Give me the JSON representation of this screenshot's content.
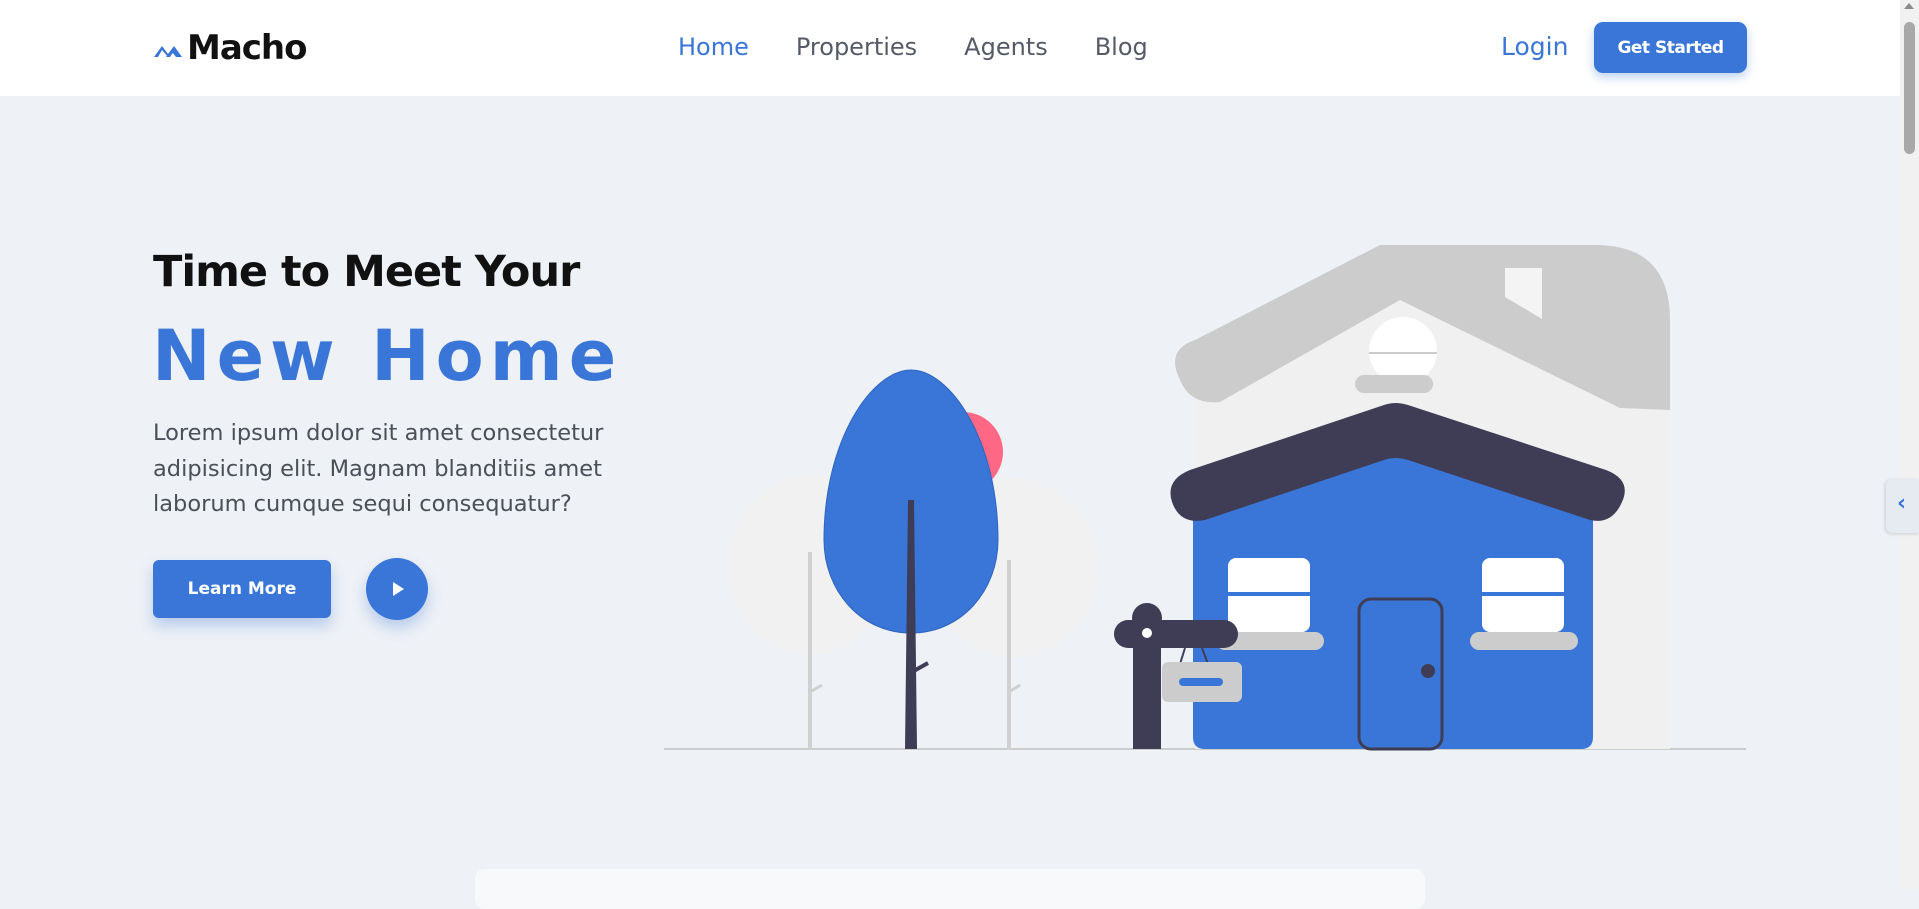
{
  "header": {
    "logo_text": "Macho",
    "nav": [
      {
        "label": "Home",
        "active": true
      },
      {
        "label": "Properties",
        "active": false
      },
      {
        "label": "Agents",
        "active": false
      },
      {
        "label": "Blog",
        "active": false
      }
    ],
    "login_label": "Login",
    "cta_label": "Get Started"
  },
  "hero": {
    "title": "Time to Meet Your",
    "highlight": "New Home",
    "description": "Lorem ipsum dolor sit amet consectetur adipisicing elit. Magnam blanditiis amet laborum cumque sequi consequatur?",
    "learn_more_label": "Learn More",
    "play_icon": "play-icon"
  },
  "side_tab": {
    "icon": "chevron-left-icon",
    "glyph": "‹"
  },
  "colors": {
    "accent": "#3a76d8",
    "background": "#eef1f6",
    "dark": "#3f3d56",
    "pink": "#ff6884",
    "light_gray": "#cccccc"
  }
}
